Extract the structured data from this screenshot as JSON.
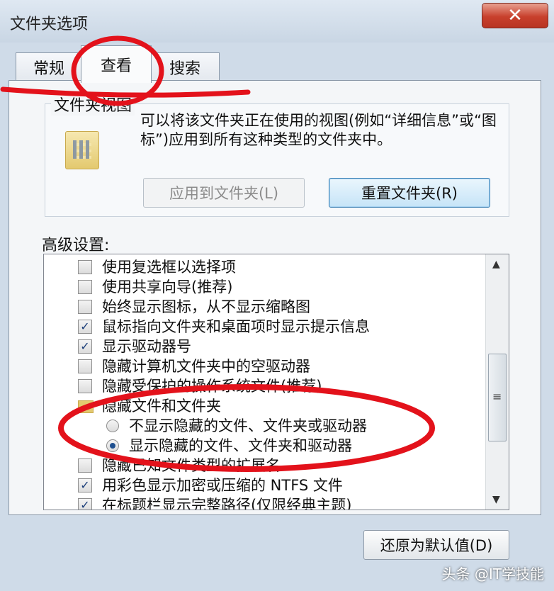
{
  "window": {
    "title": "文件夹选项",
    "close_glyph": "✕"
  },
  "tabs": [
    {
      "label": "常规"
    },
    {
      "label": "查看"
    },
    {
      "label": "搜索"
    }
  ],
  "folder_views": {
    "title": "文件夹视图",
    "description": "可以将该文件夹正在使用的视图(例如“详细信息”或“图标”)应用到所有这种类型的文件夹中。",
    "apply_button": "应用到文件夹(L)",
    "reset_button": "重置文件夹(R)"
  },
  "advanced": {
    "label": "高级设置:",
    "items": [
      {
        "label": "使用复选框以选择项",
        "checked": false
      },
      {
        "label": "使用共享向导(推荐)",
        "checked": false
      },
      {
        "label": "始终显示图标，从不显示缩略图",
        "checked": false
      },
      {
        "label": "鼠标指向文件夹和桌面项时显示提示信息",
        "checked": true
      },
      {
        "label": "显示驱动器号",
        "checked": true
      },
      {
        "label": "隐藏计算机文件夹中的空驱动器",
        "checked": false
      },
      {
        "label": "隐藏受保护的操作系统文件(推荐)",
        "checked": false
      },
      {
        "label": "隐藏文件和文件夹",
        "folder": true
      },
      {
        "label": "不显示隐藏的文件、文件夹或驱动器",
        "radio": true,
        "selected": false
      },
      {
        "label": "显示隐藏的文件、文件夹和驱动器",
        "radio": true,
        "selected": true
      },
      {
        "label": "隐藏已知文件类型的扩展名",
        "checked": false
      },
      {
        "label": "用彩色显示加密或压缩的 NTFS 文件",
        "checked": true
      },
      {
        "label": "在标题栏显示完整路径(仅限经典主题)",
        "checked": true
      }
    ],
    "check_glyph": "✓",
    "grip_glyph": "≡",
    "up_arrow": "▲",
    "down_arrow": "▼"
  },
  "restore_button": "还原为默认值(D)",
  "watermark": "头条 @IT学技能"
}
